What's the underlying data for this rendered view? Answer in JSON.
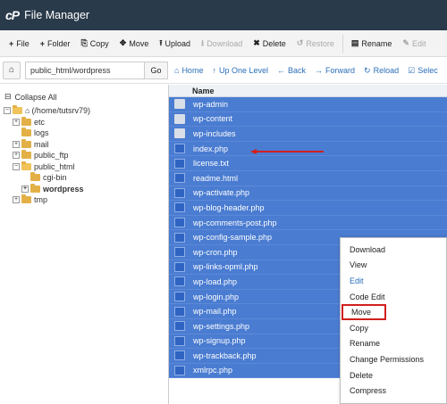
{
  "app": {
    "logo": "cP",
    "title": "File Manager"
  },
  "toolbar": {
    "buttons": [
      {
        "icon": "+",
        "label": "File",
        "disabled": false
      },
      {
        "icon": "+",
        "label": "Folder",
        "disabled": false
      },
      {
        "icon": "⎘",
        "label": "Copy",
        "disabled": false
      },
      {
        "icon": "✥",
        "label": "Move",
        "disabled": false
      },
      {
        "icon": "⭱",
        "label": "Upload",
        "disabled": false
      },
      {
        "icon": "⭳",
        "label": "Download",
        "disabled": true
      },
      {
        "icon": "✖",
        "label": "Delete",
        "disabled": false
      },
      {
        "icon": "↺",
        "label": "Restore",
        "disabled": true
      },
      {
        "icon": "▤",
        "label": "Rename",
        "disabled": false
      },
      {
        "icon": "✎",
        "label": "Edit",
        "disabled": true
      }
    ]
  },
  "pathbar": {
    "path": "public_html/wordpress",
    "go": "Go"
  },
  "nav": {
    "home": "Home",
    "up": "Up One Level",
    "back": "Back",
    "forward": "Forward",
    "reload": "Reload",
    "select": "Selec"
  },
  "sidebar": {
    "collapse_all": "Collapse All",
    "root": "(/home/tutsrv79)",
    "etc": "etc",
    "logs": "logs",
    "mail": "mail",
    "public_ftp": "public_ftp",
    "public_html": "public_html",
    "cgi_bin": "cgi-bin",
    "wordpress": "wordpress",
    "tmp": "tmp"
  },
  "filelist": {
    "header": "Name",
    "files": [
      {
        "name": "wp-admin",
        "type": "folder"
      },
      {
        "name": "wp-content",
        "type": "folder"
      },
      {
        "name": "wp-includes",
        "type": "folder"
      },
      {
        "name": "index.php",
        "type": "file"
      },
      {
        "name": "license.txt",
        "type": "file"
      },
      {
        "name": "readme.html",
        "type": "file"
      },
      {
        "name": "wp-activate.php",
        "type": "file"
      },
      {
        "name": "wp-blog-header.php",
        "type": "file"
      },
      {
        "name": "wp-comments-post.php",
        "type": "file"
      },
      {
        "name": "wp-config-sample.php",
        "type": "file"
      },
      {
        "name": "wp-cron.php",
        "type": "file"
      },
      {
        "name": "wp-links-opml.php",
        "type": "file"
      },
      {
        "name": "wp-load.php",
        "type": "file"
      },
      {
        "name": "wp-login.php",
        "type": "file"
      },
      {
        "name": "wp-mail.php",
        "type": "file"
      },
      {
        "name": "wp-settings.php",
        "type": "file"
      },
      {
        "name": "wp-signup.php",
        "type": "file"
      },
      {
        "name": "wp-trackback.php",
        "type": "file"
      },
      {
        "name": "xmlrpc.php",
        "type": "file"
      }
    ]
  },
  "context_menu": {
    "download": "Download",
    "view": "View",
    "edit": "Edit",
    "code_edit": "Code Edit",
    "move": "Move",
    "copy": "Copy",
    "rename": "Rename",
    "change_permissions": "Change Permissions",
    "delete": "Delete",
    "compress": "Compress"
  },
  "colors": {
    "titlebar": "#293a4a",
    "selection": "#4a7cd1",
    "link": "#2a6eb8",
    "highlight": "#d21f1f"
  }
}
